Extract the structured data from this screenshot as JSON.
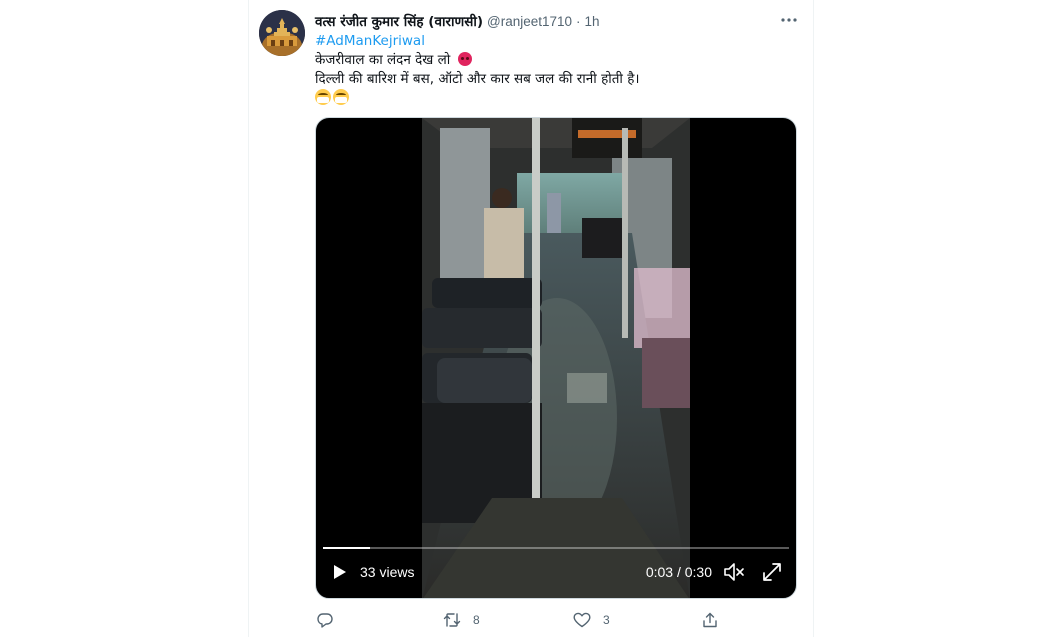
{
  "tweet": {
    "display_name": "वत्स रंजीत कुमार सिंह (वाराणसी)",
    "handle": "@ranjeet1710",
    "separator": "·",
    "time": "1h",
    "hashtag": "#AdManKejriwal",
    "line1": "केजरीवाल का लंदन देख लो",
    "line2": "दिल्ली की बारिश में बस, ऑटो और कार सब जल की रानी होती है।",
    "emojis": {
      "line1": "angry-face-icon",
      "line3": [
        "face-with-mask-icon",
        "face-with-mask-icon"
      ]
    }
  },
  "video": {
    "views": "33 views",
    "time_readout": "0:03 / 0:30",
    "progress": 0.1,
    "icons": [
      "play-icon",
      "volume-icon",
      "fullscreen-icon"
    ]
  },
  "actions": {
    "reply": {
      "icon": "reply-icon",
      "count": ""
    },
    "retweet": {
      "icon": "retweet-icon",
      "count": "8"
    },
    "like": {
      "icon": "heart-icon",
      "count": "3"
    },
    "share": {
      "icon": "share-icon",
      "count": ""
    }
  },
  "colors": {
    "link": "#1d9bf0",
    "secondary_text": "#536471",
    "primary_text": "#0f1419",
    "border": "#cfd9de"
  }
}
